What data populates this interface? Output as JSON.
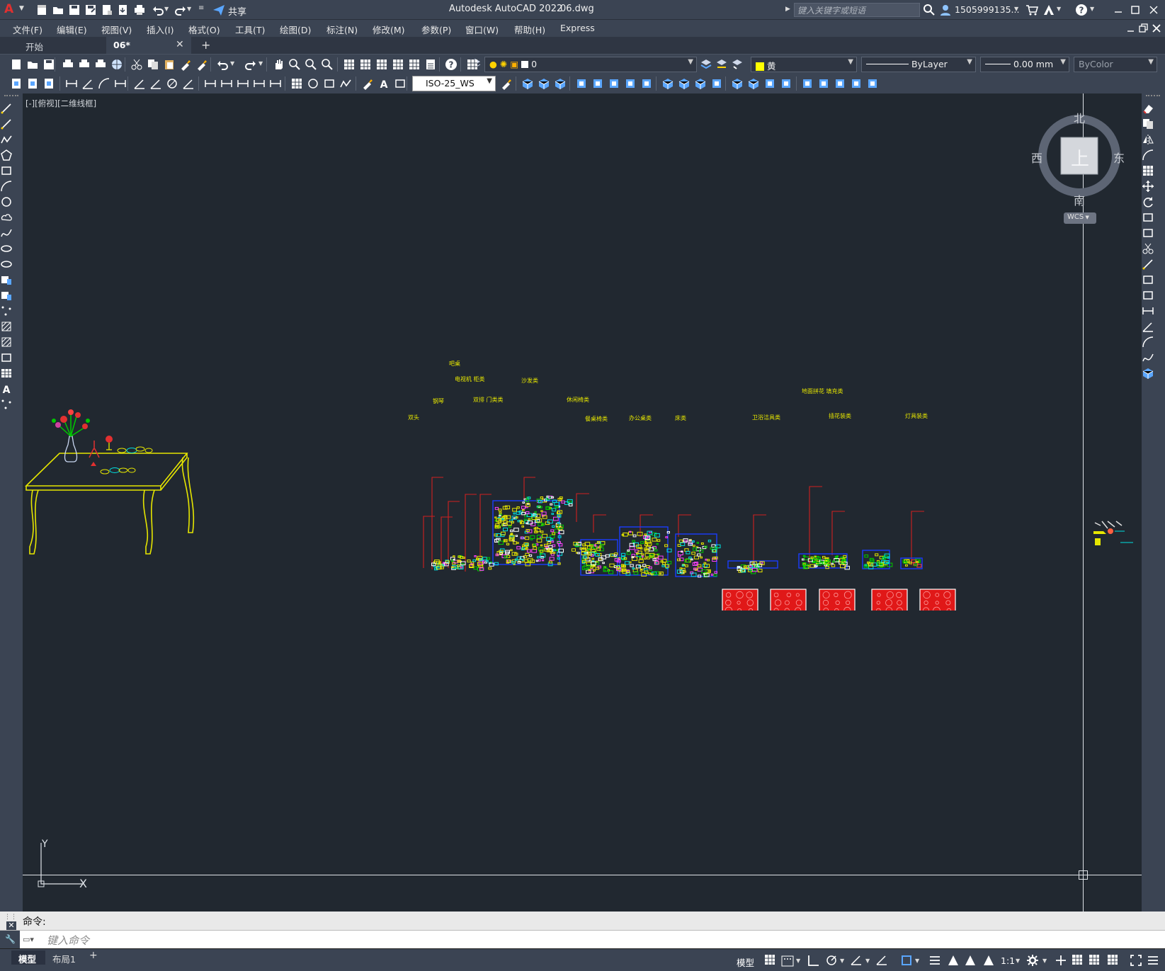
{
  "titlebar": {
    "logo": "A",
    "share_label": "共享",
    "app_title": "Autodesk AutoCAD 2022",
    "file_name": "06.dwg",
    "search_placeholder": "键入关键字或短语",
    "user_name": "1505999135...",
    "icons": [
      "new-icon",
      "open-icon",
      "save-icon",
      "saveas-icon",
      "publish-icon",
      "plot-icon",
      "undo-icon",
      "redo-icon",
      "share-icon",
      "search-icon",
      "user-icon",
      "cart-icon",
      "autodesk-icon",
      "help-icon",
      "minimize-icon",
      "maximize-icon",
      "close-icon"
    ]
  },
  "menubar": {
    "items": [
      "文件(F)",
      "编辑(E)",
      "视图(V)",
      "插入(I)",
      "格式(O)",
      "工具(T)",
      "绘图(D)",
      "标注(N)",
      "修改(M)",
      "参数(P)",
      "窗口(W)",
      "帮助(H)",
      "Express"
    ]
  },
  "tabs": {
    "items": [
      "开始",
      "06*"
    ],
    "active": "06*",
    "add_label": "+"
  },
  "toolbar": {
    "layer_value": "0",
    "color_value": "黄",
    "color_hex": "#ffff00",
    "linetype_value": "ByLayer",
    "lineweight_value": "0.00 mm",
    "plotstyle_value": "ByColor",
    "dimstyle_value": "ISO-25_WS"
  },
  "viewport": {
    "label": "[-][俯视][二维线框]",
    "viewcube": {
      "north": "北",
      "south": "南",
      "east": "东",
      "west": "西",
      "face": "上",
      "wcs": "WCS"
    },
    "ucs": {
      "x_label": "X",
      "y_label": "Y"
    },
    "block_labels": [
      "双头",
      "钢琴",
      "吧桌",
      "电视机 柜类",
      "双排 门类类",
      "沙发类",
      "休闲椅类",
      "餐桌椅类",
      "办公桌类",
      "床类",
      "卫浴洁具类",
      "地面拼花 填充类",
      "插花装类",
      "灯具装类"
    ],
    "background_hex": "#212830"
  },
  "command": {
    "history_label": "命令:",
    "input_placeholder": "键入命令"
  },
  "statusbar": {
    "layout_tabs": [
      "模型",
      "布局1"
    ],
    "add_label": "+",
    "model_button": "模型",
    "scale": "1:1"
  }
}
